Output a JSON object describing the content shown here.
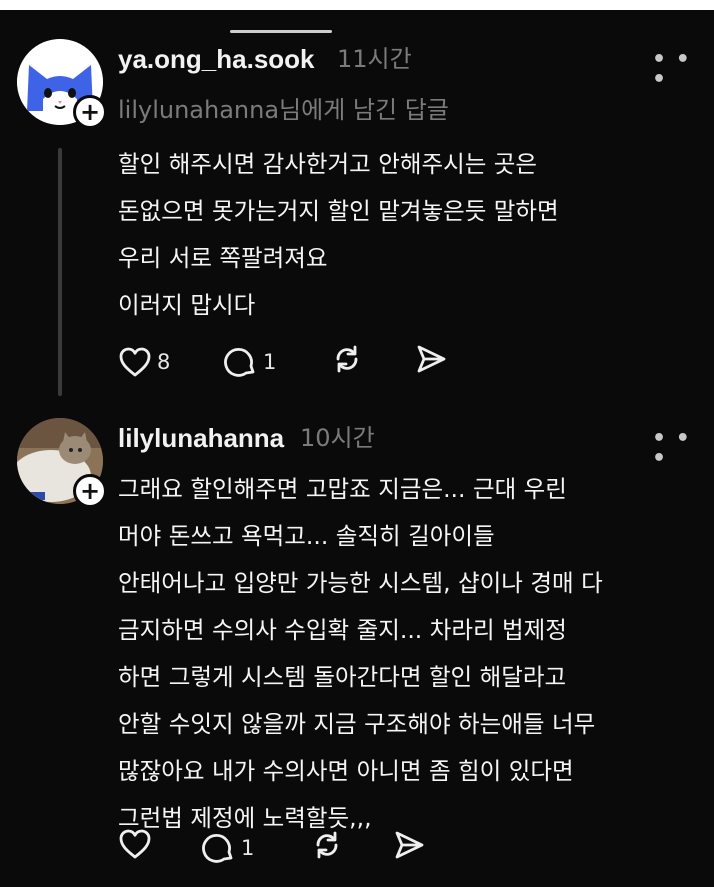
{
  "replies": [
    {
      "username": "ya.ong_ha.sook",
      "time": "11시간",
      "reply_to": "lilylunahanna님에게 남긴 답글",
      "lines": [
        "할인 해주시면 감사한거고 안해주시는 곳은",
        "돈없으면 못가는거지 할인 맡겨놓은듯 말하면",
        "우리 서로 쪽팔려져요",
        "이러지 맙시다"
      ],
      "likes": "8",
      "comments": "1"
    },
    {
      "username": "lilylunahanna",
      "time": "10시간",
      "lines": [
        "그래요 할인해주면 고맙죠 지금은... 근대 우린",
        "머야 돈쓰고 욕먹고... 솔직히 길아이들",
        "안태어나고 입양만 가능한 시스템, 샵이나 경매 다",
        "금지하면 수의사 수입확 줄지... 차라리 법제정",
        "하면 그렇게 시스템 돌아간다면 할인 해달라고",
        "안할 수잇지 않을까 지금 구조해야 하는애들 너무",
        "많잖아요 내가 수의사면 아니면 좀 힘이 있다면",
        "그런법 제정에 노력할듯,,,"
      ],
      "comments": "1"
    }
  ],
  "icons": {
    "like": "heart-icon",
    "comment": "speech-bubble-icon",
    "repost": "repost-icon",
    "share": "send-icon",
    "more": "ellipsis-icon",
    "follow": "plus-icon"
  },
  "colors": {
    "background": "#0a0a0a",
    "text": "#f3f3f3",
    "muted": "#7b7b7b",
    "avatar1_accent": "#3f63e6"
  }
}
